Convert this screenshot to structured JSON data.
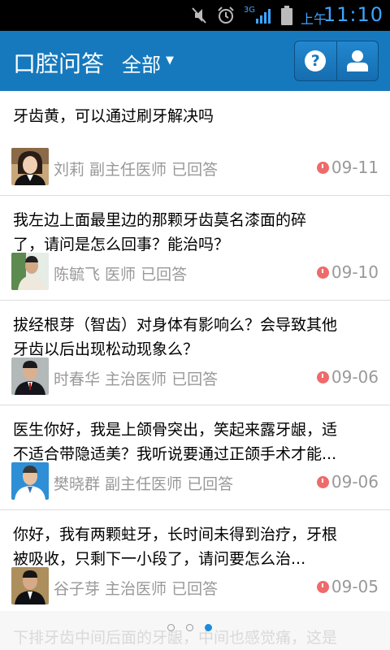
{
  "status_bar": {
    "network": "3G",
    "ampm": "上午",
    "time": "11:10"
  },
  "action_bar": {
    "title": "口腔问答",
    "filter_label": "全部",
    "help_symbol": "?"
  },
  "questions": [
    {
      "question": "牙齿黄，可以通过刷牙解决吗",
      "meta": "刘莉 副主任医师 已回答",
      "date": "09-11"
    },
    {
      "question": "我左边上面最里边的那颗牙齿莫名漆面的碎\n了，请问是怎么回事？能治吗？",
      "meta": "陈毓飞 医师 已回答",
      "date": "09-10"
    },
    {
      "question": "拔经根芽（智齿）对身体有影响么？会导致其他\n牙齿以后出现松动现象么？",
      "meta": "时春华 主治医师 已回答",
      "date": "09-06"
    },
    {
      "question": "医生你好，我是上颌骨突出，笑起来露牙龈，适\n不适合带隐适美？我听说要通过正颌手术才能...",
      "meta": "樊晓群 副主任医师 已回答",
      "date": "09-06"
    },
    {
      "question": "你好，我有两颗蛀牙，长时间未得到治疗，牙根\n被吸收，只剩下一小段了，请问要怎么治...",
      "meta": "谷子芽 主治医师 已回答",
      "date": "09-05"
    }
  ],
  "pager": {
    "peek_text": "下排牙齿中间后面的牙龈，中间也感觉痛，这是",
    "pages": 3,
    "active_page": 3
  },
  "colors": {
    "action_bar": "#1679bd",
    "status_time": "#3da5ff",
    "date_icon": "#ef6a6a",
    "meta_text": "#999999",
    "active_dot": "#1c8be0"
  }
}
